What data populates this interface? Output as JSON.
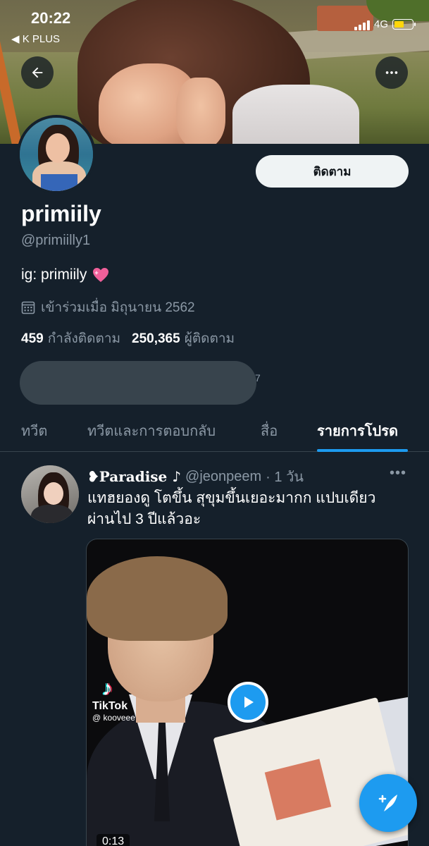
{
  "status_bar": {
    "time": "20:22",
    "back_app": "◀ K PLUS",
    "network": "4G"
  },
  "profile": {
    "follow_button": "ติดตาม",
    "display_name": "primiily",
    "handle": "@primiilly1",
    "bio": "ig: primiily",
    "joined": "เข้าร่วมเมื่อ มิถุนายน 2562",
    "following_count": "459",
    "following_label": "กำลังติดตาม",
    "followers_count": "250,365",
    "followers_label": "ผู้ติดตาม",
    "followed_by_suffix": "7"
  },
  "tabs": [
    {
      "label": "ทวีต",
      "active": false
    },
    {
      "label": "ทวีตและการตอบกลับ",
      "active": false
    },
    {
      "label": "สื่อ",
      "active": false
    },
    {
      "label": "รายการโปรด",
      "active": true
    }
  ],
  "tweet": {
    "name": "❥Paradise ♪",
    "handle": "@jeonpeem",
    "time": "· 1 วัน",
    "text_line1": "แทฮยองดู โตขึ้น สุขุมขึ้นเยอะมากก แปบเดียว",
    "text_line2": "ผ่านไป 3 ปีแล้วอะ",
    "media": {
      "watermark_brand": "TikTok",
      "watermark_user": "@ kooveee",
      "duration": "0:13"
    }
  },
  "colors": {
    "background": "#15202b",
    "accent": "#1d9bf0",
    "secondary_text": "#8b98a5",
    "divider": "#38444d"
  }
}
